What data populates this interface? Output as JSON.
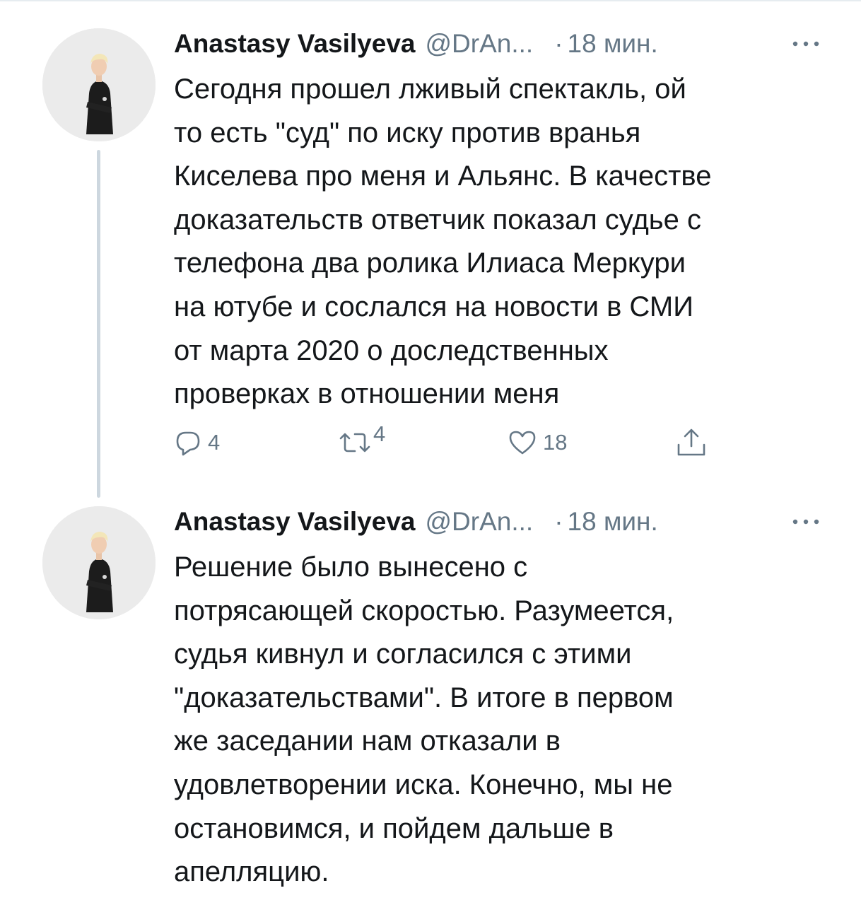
{
  "tweets": [
    {
      "display_name": "Anastasy Vasilyeva",
      "handle": "@DrAn...",
      "separator": "·",
      "time": "18 мин.",
      "text_lines": [
        "Сегодня прошел лживый спектакль, ой",
        "то есть \"суд\" по иску против вранья",
        "Киселева про меня и Альянс. В качестве",
        "доказательств ответчик показал судье с",
        "телефона два ролика Илиаса Меркури",
        "на ютубе и сослался на новости в СМИ",
        "от марта 2020 о доследственных",
        "проверках в отношении меня"
      ],
      "actions": {
        "replies": "4",
        "retweets": "4",
        "likes": "18"
      }
    },
    {
      "display_name": "Anastasy Vasilyeva",
      "handle": "@DrAn...",
      "separator": "·",
      "time": "18 мин.",
      "text_lines": [
        "Решение было вынесено с",
        "потрясающей скоростью. Разумеется,",
        "судья кивнул и согласился с этими",
        "\"доказательствами\". В итоге в первом",
        "же заседании нам отказали в",
        "удовлетворении иска. Конечно, мы не",
        "остановимся, и пойдем дальше в",
        "апелляцию."
      ]
    }
  ],
  "icons": {
    "more": "more-horizontal-icon",
    "reply": "reply-icon",
    "retweet": "retweet-icon",
    "like": "heart-icon",
    "share": "share-icon"
  },
  "colors": {
    "text": "#14171a",
    "secondary": "#657786",
    "thread_line": "#cdd7df"
  }
}
